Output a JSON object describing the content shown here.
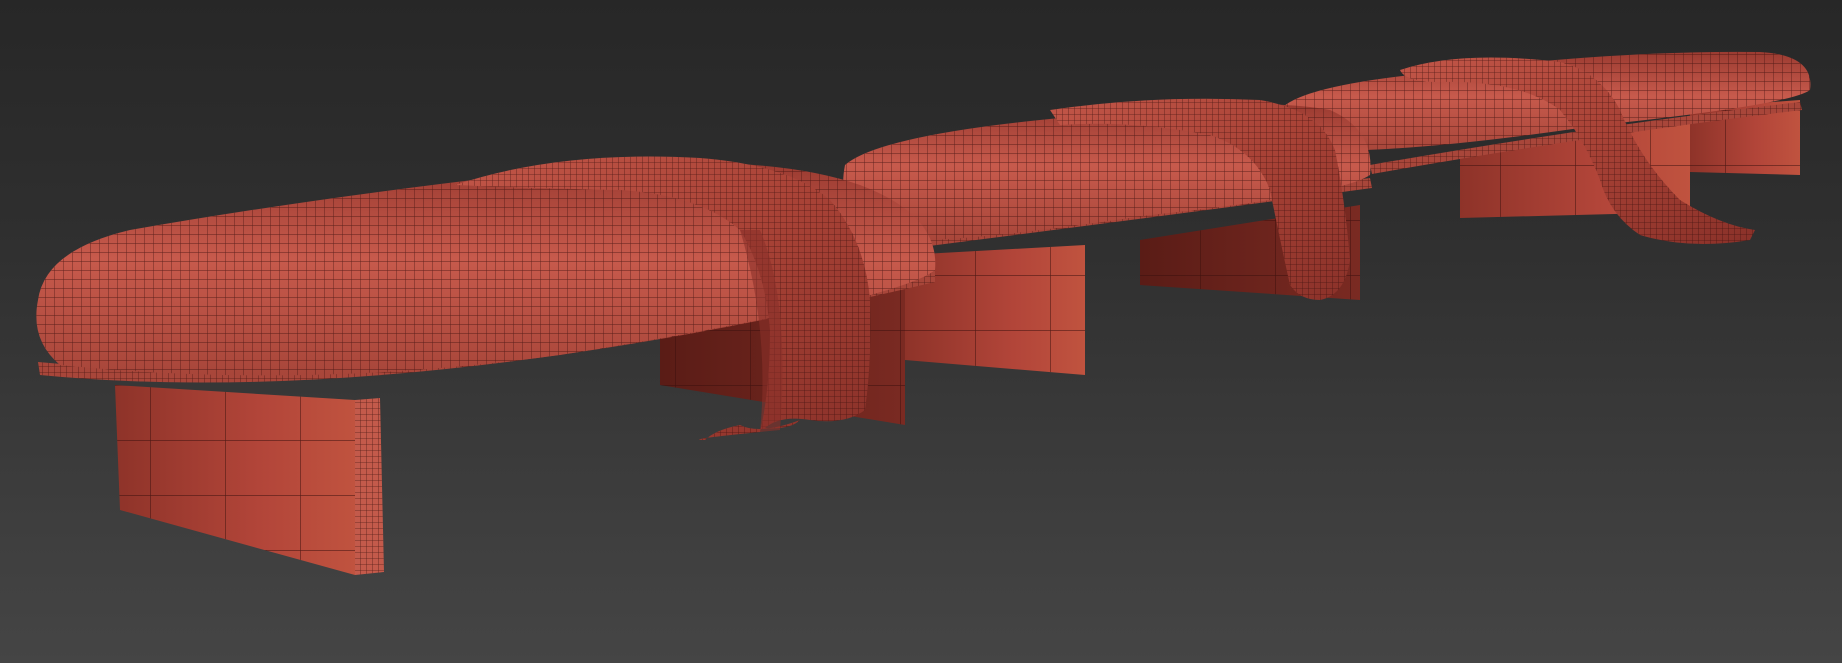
{
  "viewport": {
    "background_top": "#272727",
    "background_bottom": "#454545"
  },
  "scene": {
    "object_count": 3,
    "objects": [
      {
        "id": "bench-1",
        "has_throw": true
      },
      {
        "id": "bench-2",
        "has_throw": true
      },
      {
        "id": "bench-3",
        "has_throw": true
      }
    ]
  },
  "colors": {
    "mesh_fill": "#b54a3e",
    "mesh_fill_dark": "#7a2b24",
    "mesh_fill_light": "#cf6a5c",
    "wire": "#3a0f0c"
  }
}
